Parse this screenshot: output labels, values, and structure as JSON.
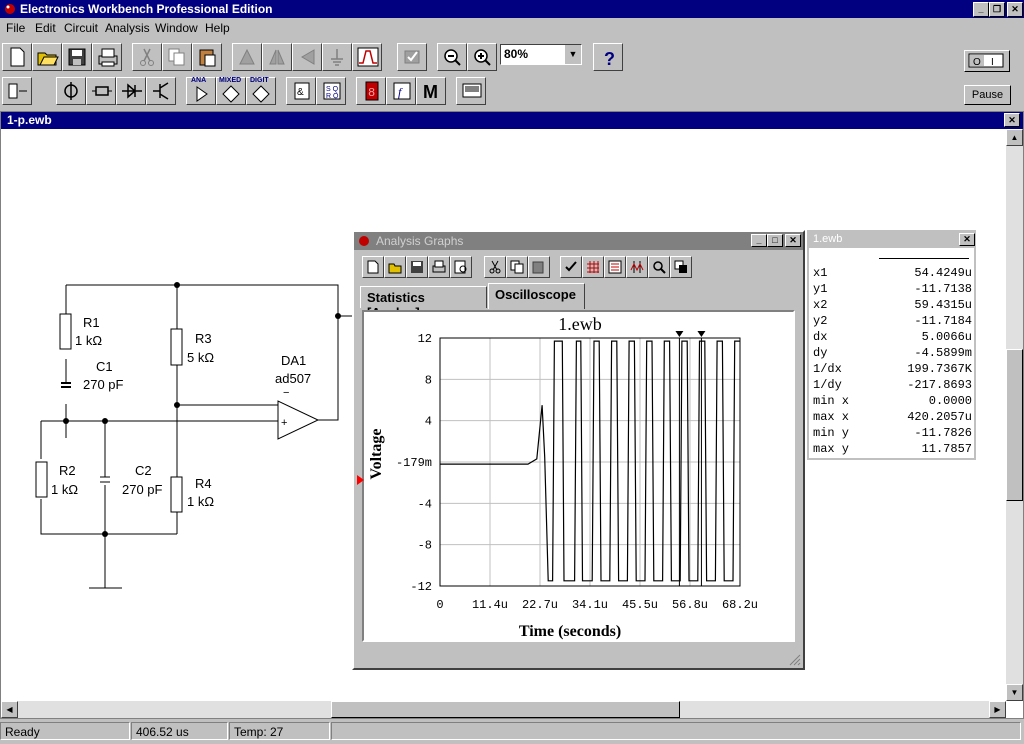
{
  "app": {
    "title": "Electronics Workbench Professional Edition"
  },
  "menu": [
    {
      "label": "File"
    },
    {
      "label": "Edit"
    },
    {
      "label": "Circuit"
    },
    {
      "label": "Analysis"
    },
    {
      "label": "Window"
    },
    {
      "label": "Help"
    }
  ],
  "toolbar": {
    "zoom": "80%",
    "pause_label": "Pause",
    "part_bin_labels": {
      "analog": "ANA",
      "mixed": "MIXED",
      "digital": "DIGIT"
    }
  },
  "document": {
    "title": "1-p.ewb"
  },
  "circuit": {
    "components": [
      {
        "ref": "R1",
        "value": "1 kΩ"
      },
      {
        "ref": "C1",
        "value": "270 pF"
      },
      {
        "ref": "R3",
        "value": "5 kΩ"
      },
      {
        "ref": "DA1",
        "value": "ad507"
      },
      {
        "ref": "R2",
        "value": "1 kΩ"
      },
      {
        "ref": "C2",
        "value": "270 pF"
      },
      {
        "ref": "R4",
        "value": "1 kΩ"
      }
    ]
  },
  "analysis_graphs": {
    "title": "Analysis Graphs",
    "tabs": [
      {
        "label": "Statistics [Analog]"
      },
      {
        "label": "Oscilloscope"
      }
    ],
    "active_tab": "Oscilloscope"
  },
  "chart_data": {
    "type": "line",
    "title": "1.ewb",
    "xlabel": "Time (seconds)",
    "ylabel": "Voltage",
    "x_ticks": [
      "0",
      "11.4u",
      "22.7u",
      "34.1u",
      "45.5u",
      "56.8u",
      "68.2u"
    ],
    "y_ticks": [
      "12",
      "8",
      "4",
      "-179m",
      "-4",
      "-8",
      "-12"
    ],
    "xlim": [
      0,
      68.2
    ],
    "ylim": [
      -12,
      12
    ],
    "grid": true,
    "series": [
      {
        "x": [
          0,
          20,
          22,
          23.2,
          23.8,
          24.6,
          25.6,
          26.0,
          27.8,
          28.2,
          30.6,
          31.0,
          32.0,
          32.4,
          34.6,
          35.0,
          36.2,
          36.6,
          38.6,
          39.0,
          40.2,
          40.6,
          42.6,
          43.0,
          44.2,
          44.6,
          46.6,
          47.0,
          48.2,
          48.6,
          50.6,
          51.0,
          52.2,
          52.6,
          54.6,
          55.0,
          56.2,
          56.6,
          58.6,
          59.0,
          60.2,
          60.6,
          62.6,
          63.0,
          64.2,
          64.6,
          66.6,
          67.0,
          68.2
        ],
        "y": [
          -0.2,
          -0.2,
          0.3,
          5.5,
          0.5,
          -11.5,
          -11.5,
          11.7,
          11.7,
          -11.5,
          -11.5,
          11.7,
          11.7,
          -11.5,
          -11.5,
          11.7,
          11.7,
          -11.5,
          -11.5,
          11.7,
          11.7,
          -11.5,
          -11.5,
          11.7,
          11.7,
          -11.5,
          -11.5,
          11.7,
          11.7,
          -11.5,
          -11.5,
          11.7,
          11.7,
          -11.5,
          -11.5,
          11.7,
          11.7,
          -11.5,
          -11.5,
          11.7,
          11.7,
          -11.5,
          -11.5,
          11.7,
          11.7,
          -11.5,
          -11.5,
          11.7,
          11.7
        ]
      }
    ],
    "cursors_x": [
      54.4249,
      59.4315
    ],
    "line_color": "#000000"
  },
  "cursor_window": {
    "title": "1.ewb",
    "rows": [
      {
        "k": "x1",
        "v": "54.4249u"
      },
      {
        "k": "y1",
        "v": "-11.7138"
      },
      {
        "k": "x2",
        "v": "59.4315u"
      },
      {
        "k": "y2",
        "v": "-11.7184"
      },
      {
        "k": "dx",
        "v": "5.0066u"
      },
      {
        "k": "dy",
        "v": "-4.5899m"
      },
      {
        "k": "1/dx",
        "v": "199.7367K"
      },
      {
        "k": "1/dy",
        "v": "-217.8693"
      },
      {
        "k": "min x",
        "v": "0.0000"
      },
      {
        "k": "max x",
        "v": "420.2057u"
      },
      {
        "k": "min y",
        "v": "-11.7826"
      },
      {
        "k": "max y",
        "v": "11.7857"
      }
    ]
  },
  "status": {
    "state": "Ready",
    "time": "406.52 us",
    "temp": "Temp:  27"
  },
  "colors": {
    "titlebar": "#000080",
    "face": "#c0c0c0",
    "cursor_marker": "#ff0000"
  }
}
